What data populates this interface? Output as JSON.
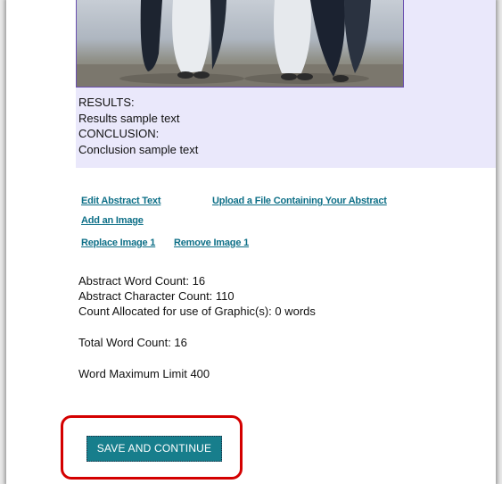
{
  "abstract": {
    "results_heading": "RESULTS:",
    "results_text": "Results sample text",
    "conclusion_heading": "CONCLUSION:",
    "conclusion_text": "Conclusion sample text"
  },
  "links": {
    "edit_abstract": "Edit Abstract Text",
    "upload_file": "Upload a File Containing Your Abstract",
    "add_image": "Add an Image",
    "replace_image": "Replace Image 1",
    "remove_image": "Remove Image 1"
  },
  "stats": {
    "word_count": "Abstract Word Count:  16",
    "char_count": "Abstract Character Count:  110",
    "graphic_count": "Count Allocated for use of Graphic(s):  0 words",
    "total_count": "Total Word Count:  16",
    "max_limit": "Word Maximum Limit 400"
  },
  "actions": {
    "save_continue": "SAVE AND CONTINUE"
  },
  "colors": {
    "link": "#0d6f87",
    "button": "#177e8c",
    "highlight": "#d40000",
    "panel": "#eae8fb"
  },
  "image": {
    "subject": "penguins-photo"
  }
}
